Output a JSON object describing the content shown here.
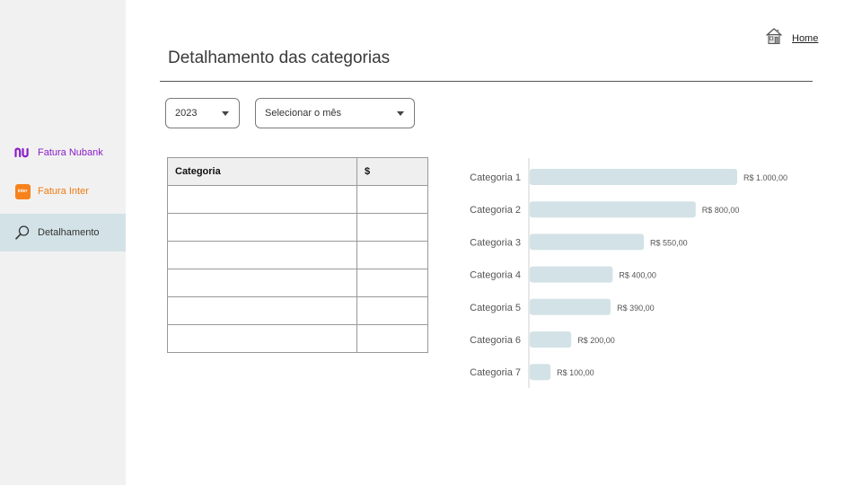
{
  "sidebar": {
    "items": [
      {
        "label": "Fatura Nubank",
        "icon": "nubank-logo-icon"
      },
      {
        "label": "Fatura Inter",
        "icon": "inter-logo-icon",
        "icon_text": "inter"
      },
      {
        "label": "Detalhamento",
        "icon": "magnifier-icon",
        "active": true
      }
    ]
  },
  "header": {
    "home_label": "Home",
    "title": "Detalhamento das categorias"
  },
  "filters": {
    "year": "2023",
    "month": "Selecionar o mês"
  },
  "table": {
    "headers": [
      "Categoria",
      "$"
    ],
    "rows": [
      [
        "",
        ""
      ],
      [
        "",
        ""
      ],
      [
        "",
        ""
      ],
      [
        "",
        ""
      ],
      [
        "",
        ""
      ],
      [
        "",
        ""
      ]
    ]
  },
  "colors": {
    "nubank": "#8a1ec8",
    "inter": "#f07a12",
    "active_nav": "#d3e2e6",
    "bar": "#d3e2e6"
  },
  "chart_data": {
    "type": "bar",
    "orientation": "horizontal",
    "categories": [
      "Categoria 1",
      "Categoria 2",
      "Categoria 3",
      "Categoria 4",
      "Categoria 5",
      "Categoria 6",
      "Categoria 7"
    ],
    "values": [
      1000,
      800,
      550,
      400,
      390,
      200,
      100
    ],
    "value_labels": [
      "R$ 1.000,00",
      "R$ 800,00",
      "R$ 550,00",
      "R$ 400,00",
      "R$ 390,00",
      "R$ 200,00",
      "R$ 100,00"
    ],
    "xlim": [
      0,
      1000
    ],
    "grid": false
  }
}
